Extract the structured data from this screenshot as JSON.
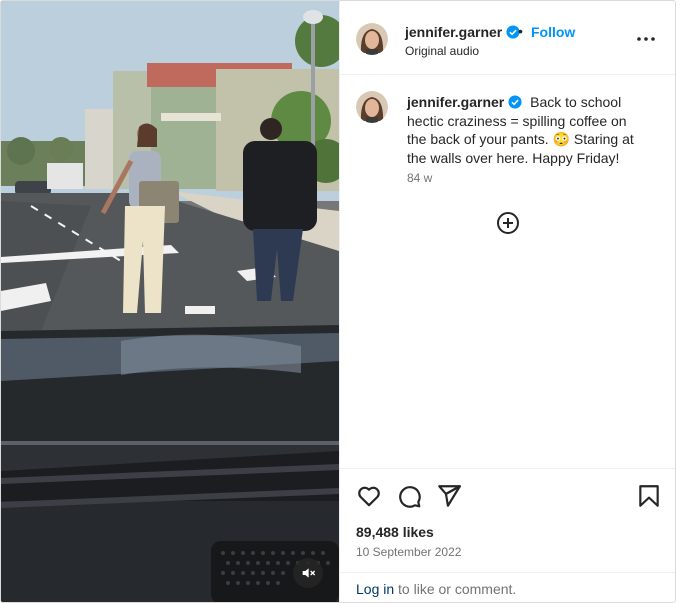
{
  "post": {
    "username": "jennifer.garner",
    "dot": "•",
    "follow_label": "Follow",
    "audio": "Original audio",
    "caption": "Back to school hectic craziness = spilling coffee on the back of your pants. 😳 Staring at the walls over here. Happy Friday!",
    "time_ago": "84 w",
    "likes": "89,488 likes",
    "date": "10 September 2022",
    "login_link": "Log in",
    "login_rest": " to like or comment."
  },
  "icons": {
    "verified": "verified-badge-icon",
    "more": "more-options-icon",
    "add_comments": "plus-circle-icon",
    "like": "heart-icon",
    "comment": "comment-icon",
    "share": "share-icon",
    "save": "bookmark-icon",
    "mute": "muted-speaker-icon"
  },
  "colors": {
    "link": "#0095f6",
    "login_link": "#00376b",
    "verified": "#0095f6",
    "muted_text": "#737373"
  }
}
